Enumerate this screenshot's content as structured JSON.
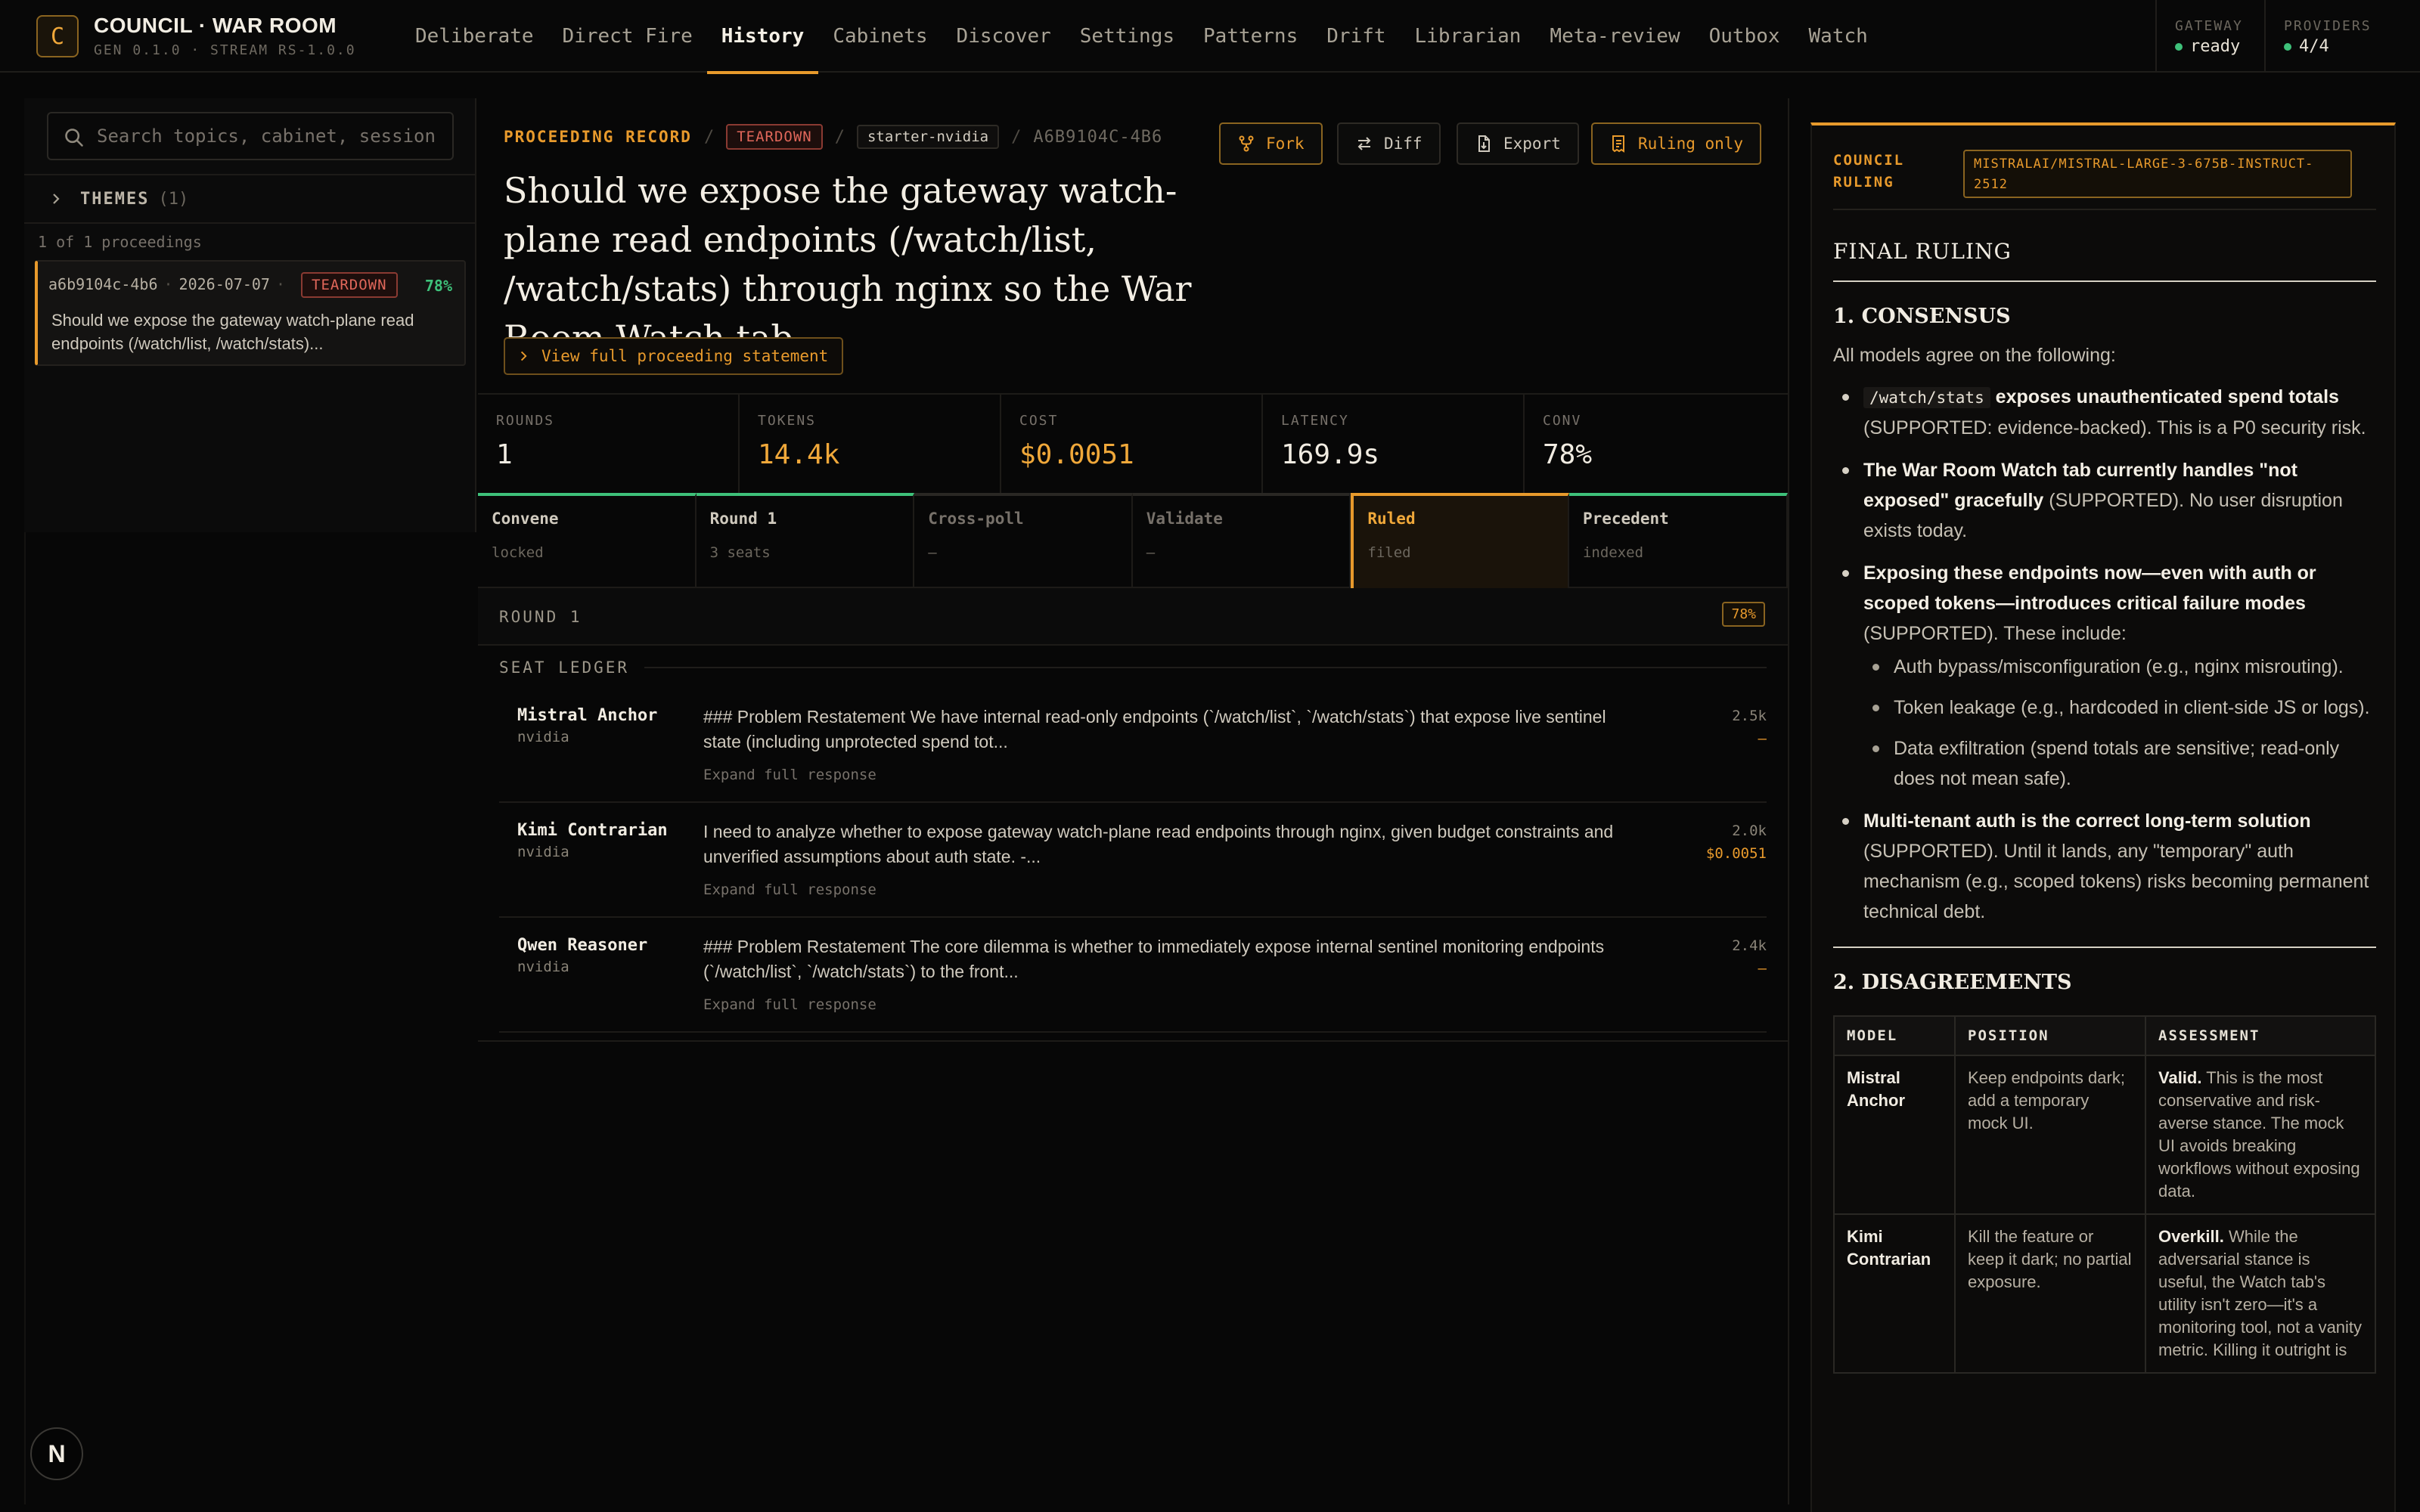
{
  "app": {
    "logo_letter": "C",
    "title": "COUNCIL · WAR ROOM",
    "version": "GEN 0.1.0 · STREAM RS-1.0.0"
  },
  "nav": {
    "items": [
      "Deliberate",
      "Direct Fire",
      "History",
      "Cabinets",
      "Discover",
      "Settings",
      "Patterns",
      "Drift",
      "Librarian",
      "Meta-review",
      "Outbox",
      "Watch"
    ],
    "active": "History"
  },
  "status": {
    "gateway_label": "GATEWAY",
    "gateway_value": "ready",
    "providers_label": "PROVIDERS",
    "providers_value": "4/4",
    "ok_color": "#3ec17a"
  },
  "sidebar": {
    "search_placeholder": "Search topics, cabinet, session id",
    "themes_label": "THEMES",
    "themes_count": "(1)",
    "count_line": "1 of 1 proceedings",
    "proceeding": {
      "id": "a6b9104c-4b6",
      "date": "2026-07-07",
      "badge": "TEARDOWN",
      "pct": "78%",
      "text": "Should we expose the gateway watch-plane read endpoints (/watch/list, /watch/stats)..."
    }
  },
  "record": {
    "kicker": "PROCEEDING RECORD",
    "badge": "TEARDOWN",
    "cabinet": "starter-nvidia",
    "id": "A6B9104C-4B6",
    "title": "Should we expose the gateway watch-plane read endpoints (/watch/list, /watch/stats) through nginx so the War Room Watch tab...",
    "view_full": "View full proceeding statement",
    "actions": {
      "fork": "Fork",
      "diff": "Diff",
      "export": "Export",
      "ruling_only": "Ruling only"
    }
  },
  "stats": [
    {
      "label": "ROUNDS",
      "value": "1"
    },
    {
      "label": "TOKENS",
      "value": "14.4k"
    },
    {
      "label": "COST",
      "value": "$0.0051"
    },
    {
      "label": "LATENCY",
      "value": "169.9s"
    },
    {
      "label": "CONV",
      "value": "78%"
    }
  ],
  "stages": [
    {
      "name": "Convene",
      "sub": "locked"
    },
    {
      "name": "Round 1",
      "sub": "3 seats"
    },
    {
      "name": "Cross-poll",
      "sub": "—"
    },
    {
      "name": "Validate",
      "sub": "—"
    },
    {
      "name": "Ruled",
      "sub": "filed"
    },
    {
      "name": "Precedent",
      "sub": "indexed"
    }
  ],
  "round": {
    "label": "ROUND 1",
    "pct": "78%"
  },
  "ledger": {
    "title": "SEAT LEDGER",
    "expand_label": "Expand full response",
    "seats": [
      {
        "name": "Mistral Anchor",
        "provider": "nvidia",
        "body": "### Problem Restatement We have internal read-only endpoints (`/watch/list`, `/watch/stats`) that expose live sentinel state (including unprotected spend tot...",
        "tokens": "2.5k",
        "cost": "—"
      },
      {
        "name": "Kimi Contrarian",
        "provider": "nvidia",
        "body": "I need to analyze whether to expose gateway watch-plane read endpoints through nginx, given budget constraints and unverified assumptions about auth state. -...",
        "tokens": "2.0k",
        "cost": "$0.0051"
      },
      {
        "name": "Qwen Reasoner",
        "provider": "nvidia",
        "body": "### Problem Restatement The core dilemma is whether to immediately expose internal sentinel monitoring endpoints (`/watch/list`, `/watch/stats`) to the front...",
        "tokens": "2.4k",
        "cost": "—"
      }
    ]
  },
  "ruling": {
    "kicker": "COUNCIL RULING",
    "model": "MISTRALAI/MISTRAL-LARGE-3-675B-INSTRUCT-2512",
    "final": "FINAL RULING",
    "consensus_h": "1. CONSENSUS",
    "consensus_intro": "All models agree on the following:",
    "b1_code": "/watch/stats",
    "b1_bold": "exposes unauthenticated spend totals",
    "b1_rest": "(SUPPORTED: evidence-backed). This is a P0 security risk.",
    "b2_bold": "The War Room Watch tab currently handles \"not exposed\" gracefully",
    "b2_rest": "(SUPPORTED). No user disruption exists today.",
    "b3_bold": "Exposing these endpoints now—even with auth or scoped tokens—introduces critical failure modes",
    "b3_rest": "(SUPPORTED). These include:",
    "b3_sub": [
      "Auth bypass/misconfiguration (e.g., nginx misrouting).",
      "Token leakage (e.g., hardcoded in client-side JS or logs).",
      "Data exfiltration (spend totals are sensitive; read-only does not mean safe)."
    ],
    "b4_bold": "Multi-tenant auth is the correct long-term solution",
    "b4_rest": "(SUPPORTED). Until it lands, any \"temporary\" auth mechanism (e.g., scoped tokens) risks becoming permanent technical debt.",
    "disagree_h": "2. DISAGREEMENTS",
    "table_headers": [
      "MODEL",
      "POSITION",
      "ASSESSMENT"
    ],
    "rows": [
      {
        "model": "Mistral Anchor",
        "position": "Keep endpoints dark; add a temporary mock UI.",
        "assess_bold": "Valid.",
        "assess": "This is the most conservative and risk-averse stance. The mock UI avoids breaking workflows without exposing data."
      },
      {
        "model": "Kimi Contrarian",
        "position": "Kill the feature or keep it dark; no partial exposure.",
        "assess_bold": "Overkill.",
        "assess": "While the adversarial stance is useful, the Watch tab's utility isn't zero—it's a monitoring tool, not a vanity metric. Killing it outright is"
      }
    ]
  },
  "footer": {
    "next_letter": "N"
  },
  "colors": {
    "accent": "#e89a2c",
    "danger": "#e0675a",
    "success": "#3ec17a",
    "background": "#070707"
  }
}
